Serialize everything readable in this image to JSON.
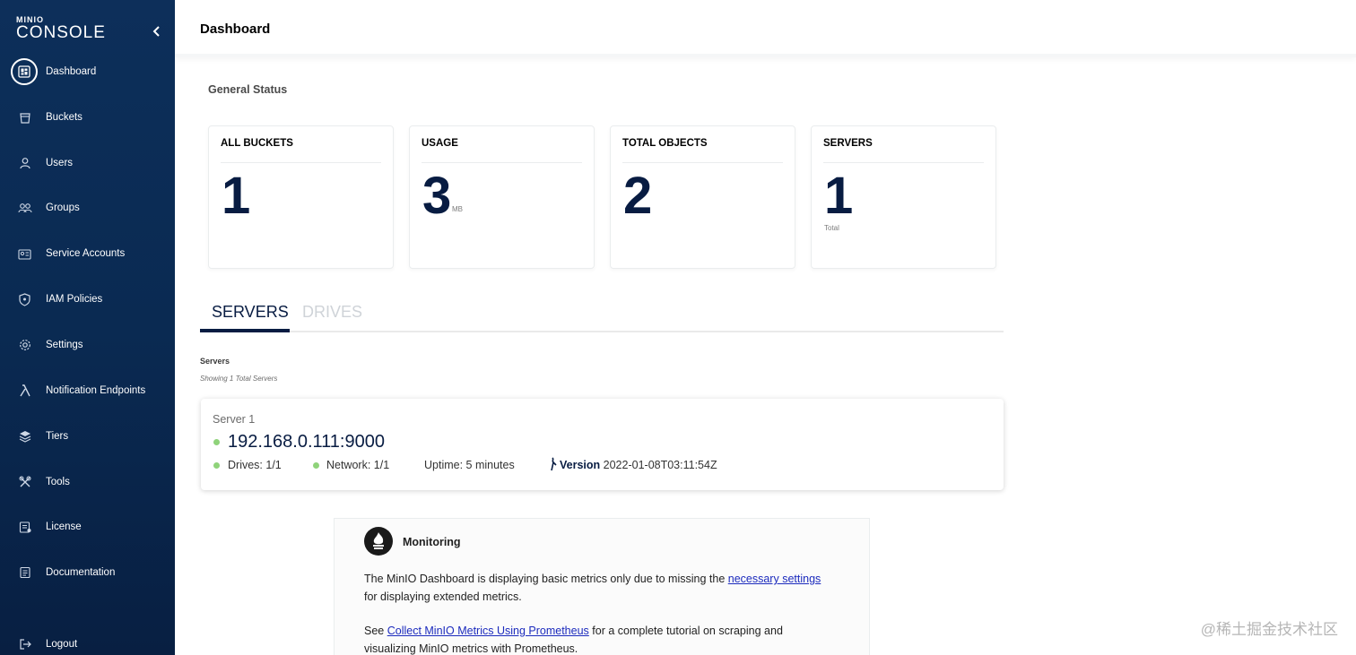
{
  "app": {
    "brand": "MINIO",
    "product": "CONSOLE"
  },
  "sidebar": {
    "items": [
      {
        "label": "Dashboard",
        "icon": "dashboard-icon",
        "active": true
      },
      {
        "label": "Buckets",
        "icon": "bucket-icon"
      },
      {
        "label": "Users",
        "icon": "user-icon"
      },
      {
        "label": "Groups",
        "icon": "groups-icon"
      },
      {
        "label": "Service Accounts",
        "icon": "service-accounts-icon"
      },
      {
        "label": "IAM Policies",
        "icon": "shield-icon"
      },
      {
        "label": "Settings",
        "icon": "gear-icon"
      },
      {
        "label": "Notification Endpoints",
        "icon": "lambda-icon"
      },
      {
        "label": "Tiers",
        "icon": "layers-icon"
      },
      {
        "label": "Tools",
        "icon": "tools-icon"
      },
      {
        "label": "License",
        "icon": "license-icon"
      },
      {
        "label": "Documentation",
        "icon": "documentation-icon"
      }
    ],
    "logout": "Logout"
  },
  "header": {
    "title": "Dashboard"
  },
  "general_status": {
    "title": "General Status",
    "cards": [
      {
        "label": "ALL BUCKETS",
        "value": "1",
        "unit": ""
      },
      {
        "label": "USAGE",
        "value": "3",
        "unit": "MB"
      },
      {
        "label": "TOTAL OBJECTS",
        "value": "2",
        "unit": ""
      },
      {
        "label": "SERVERS",
        "value": "1",
        "unit": "Total"
      }
    ]
  },
  "tabs": {
    "servers": "SERVERS",
    "drives": "DRIVES",
    "active": "SERVERS"
  },
  "servers": {
    "heading": "Servers",
    "subheading": "Showing 1 Total Servers",
    "list": [
      {
        "name": "Server 1",
        "endpoint": "192.168.0.111:9000",
        "drives": "Drives: 1/1",
        "network": "Network: 1/1",
        "uptime": "Uptime: 5 minutes",
        "version_label": "Version",
        "version": "2022-01-08T03:11:54Z"
      }
    ]
  },
  "monitoring": {
    "title": "Monitoring",
    "p1_before": "The MinIO Dashboard is displaying basic metrics only due to missing the ",
    "p1_link": "necessary settings",
    "p1_after": " for displaying extended metrics.",
    "p2_before": "See ",
    "p2_link": "Collect MinIO Metrics Using Prometheus",
    "p2_after": " for a complete tutorial on scraping and visualizing MinIO metrics with Prometheus."
  },
  "watermark": "@稀土掘金技术社区",
  "colors": {
    "sidebar": "#0d2f5a",
    "accent": "#081c42",
    "status_ok": "#8fd37a",
    "link": "#1c2bbd"
  }
}
